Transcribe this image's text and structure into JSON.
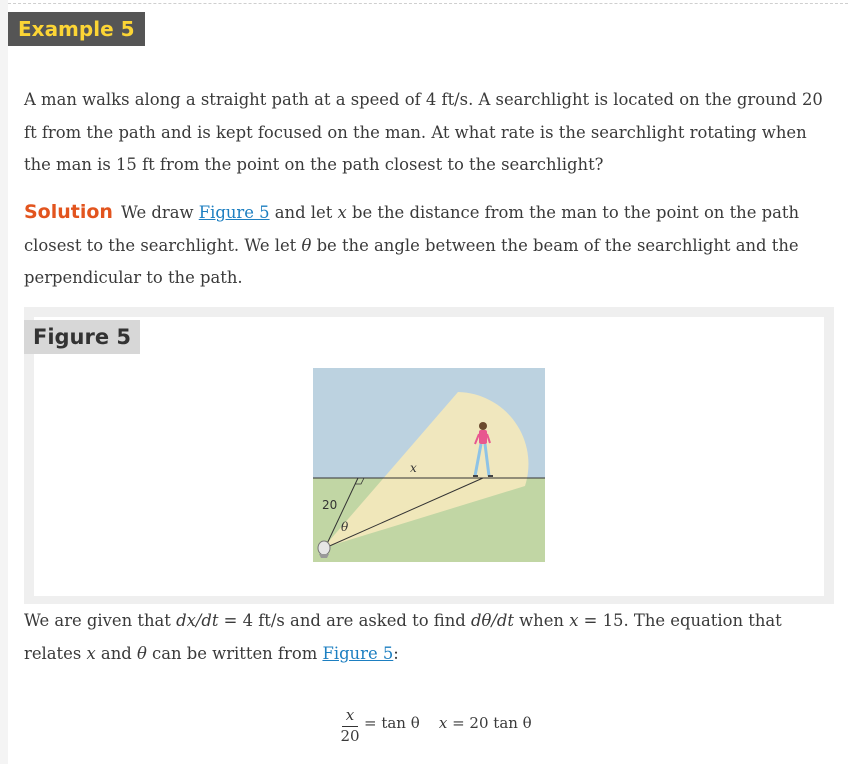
{
  "example": {
    "label": "Example 5"
  },
  "problem": {
    "text": "A man walks along a straight path at a speed of 4 ft/s. A searchlight is located on the ground 20 ft from the path and is kept focused on the man. At what rate is the searchlight rotating when the man is 15 ft from the point on the path closest to the searchlight?"
  },
  "solution": {
    "label": "Solution",
    "t1": "We draw ",
    "link": "Figure 5",
    "t2": " and let ",
    "x": "x",
    "t3": " be the distance from the man to the point on the path closest to the searchlight. We let ",
    "theta": "θ",
    "t4": " be the angle between the beam of the searchlight and the perpendicular to the path."
  },
  "figure": {
    "label": "Figure 5",
    "label_x": "x",
    "label_20": "20",
    "label_theta": "θ",
    "colors": {
      "sky": "#bcd2e0",
      "ground": "#c1d6a4",
      "beam": "#f2e8bc",
      "shirt": "#e8578f",
      "pants": "#8ec3e6"
    }
  },
  "given": {
    "t1": "We are given that ",
    "m1": "dx/dt",
    "t2": " = 4 ft/s and are asked to find ",
    "m2": "dθ/dt",
    "t3": " when ",
    "m3": "x",
    "t4": " = 15. The equation that relates ",
    "m4": "x",
    "t5": " and ",
    "m5": "θ",
    "t6": " can be written from ",
    "link": "Figure 5",
    "t7": ":"
  },
  "equation": {
    "numerator": "x",
    "denominator": "20",
    "rhs1": "= tan θ",
    "lhs2": "x",
    "rhs2": " = 20 tan θ"
  }
}
